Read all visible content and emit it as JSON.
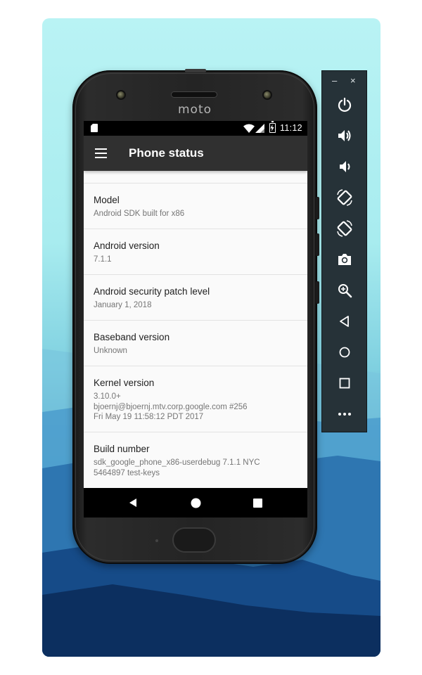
{
  "device": {
    "brand_logo": "moto"
  },
  "status_bar": {
    "time": "11:12"
  },
  "toolbar": {
    "title": "Phone status"
  },
  "items": [
    {
      "label": "Model",
      "value": "Android SDK built for x86"
    },
    {
      "label": "Android version",
      "value": "7.1.1"
    },
    {
      "label": "Android security patch level",
      "value": "January 1, 2018"
    },
    {
      "label": "Baseband version",
      "value": "Unknown"
    },
    {
      "label": "Kernel version",
      "value": "3.10.0+\nbjoernj@bjoernj.mtv.corp.google.com #256\nFri May 19 11:58:12 PDT 2017"
    },
    {
      "label": "Build number",
      "value": "sdk_google_phone_x86-userdebug 7.1.1 NYC\n5464897 test-keys"
    }
  ],
  "emulator_toolbar": {
    "minimize": "–",
    "close": "×",
    "buttons": [
      "power-icon",
      "volume-up-icon",
      "volume-down-icon",
      "rotate-left-icon",
      "rotate-right-icon",
      "camera-icon",
      "zoom-icon",
      "back-icon",
      "home-icon",
      "overview-icon",
      "more-icon"
    ]
  },
  "colors": {
    "toolbar": "#303030",
    "statusbar": "#000000",
    "list_bg": "#fafafa",
    "emu_bar": "#263238"
  }
}
